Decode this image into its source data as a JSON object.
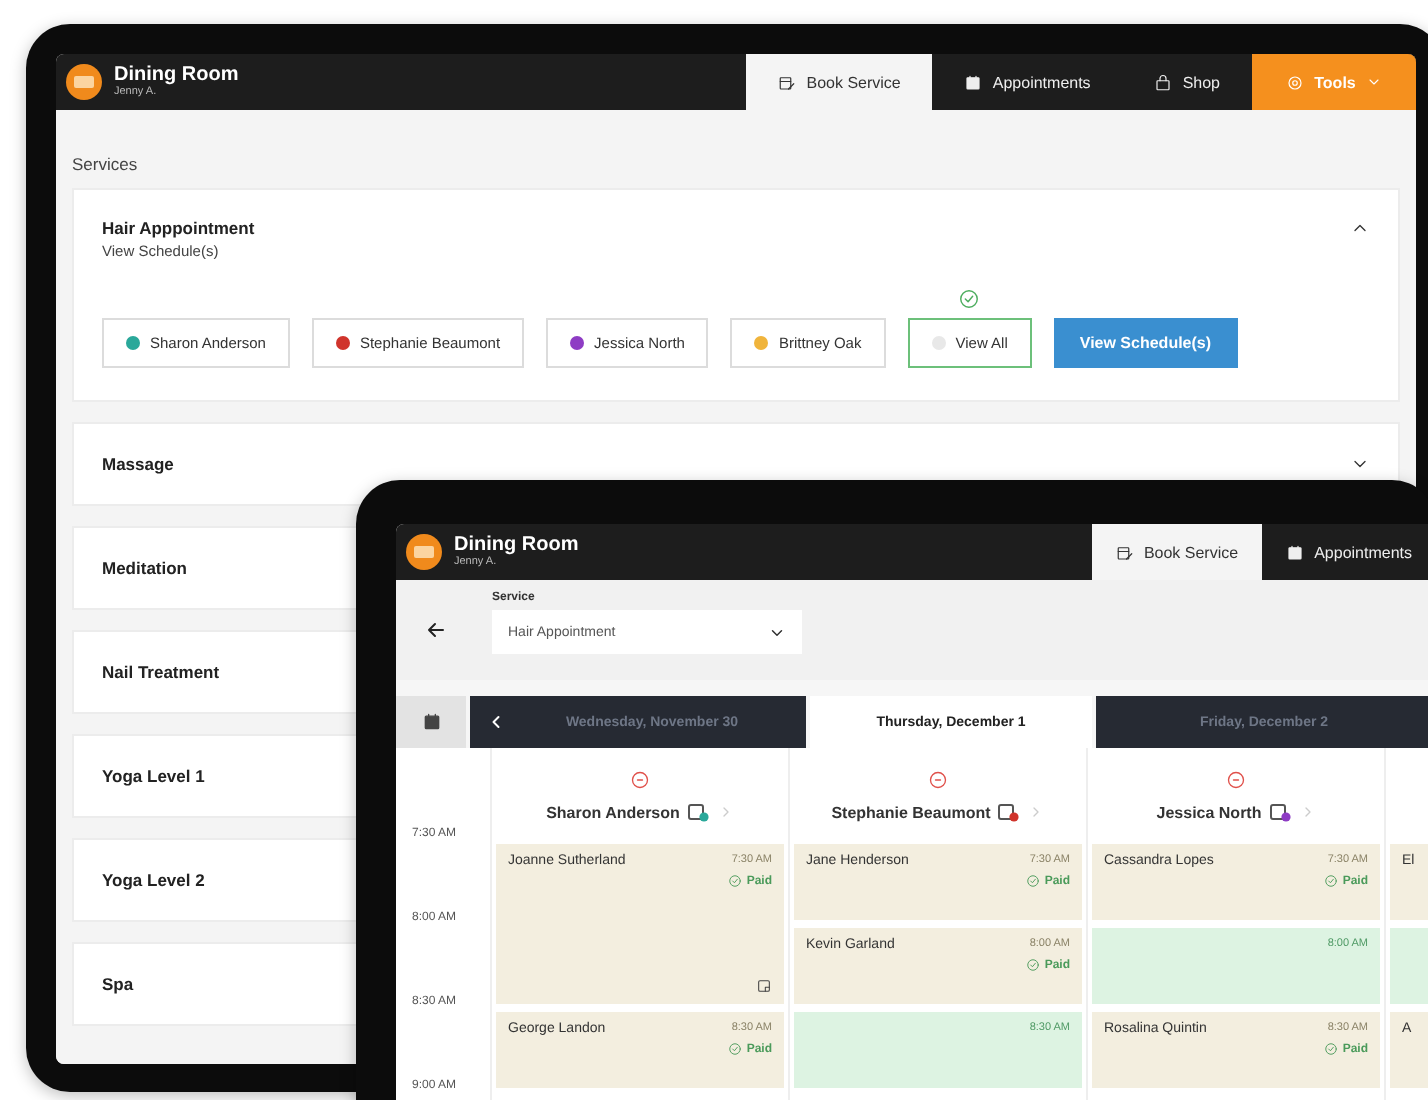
{
  "back_tablet": {
    "header": {
      "title": "Dining Room",
      "subtitle": "Jenny A.",
      "tabs": [
        {
          "label": "Book Service",
          "selected": true,
          "kind": "tab"
        },
        {
          "label": "Appointments",
          "selected": false,
          "kind": "tab"
        },
        {
          "label": "Shop",
          "selected": false,
          "kind": "tab"
        },
        {
          "label": "Tools",
          "selected": false,
          "kind": "menu"
        }
      ]
    },
    "section_label": "Services",
    "services": [
      {
        "name": "Hair Apppointment",
        "subtitle": "View Schedule(s)",
        "expanded": true,
        "staff": [
          {
            "name": "Sharon Anderson",
            "color": "#2aa89a",
            "selected": false
          },
          {
            "name": "Stephanie Beaumont",
            "color": "#d0342c",
            "selected": false
          },
          {
            "name": "Jessica North",
            "color": "#8e3cc4",
            "selected": false
          },
          {
            "name": "Brittney Oak",
            "color": "#f0b43c",
            "selected": false
          },
          {
            "name": "View All",
            "color": "#e8e8e8",
            "selected": true
          }
        ],
        "action": "View Schedule(s)"
      },
      {
        "name": "Massage",
        "expanded": false
      },
      {
        "name": "Meditation",
        "expanded": false
      },
      {
        "name": "Nail Treatment",
        "expanded": false
      },
      {
        "name": "Yoga Level 1",
        "expanded": false
      },
      {
        "name": "Yoga Level 2",
        "expanded": false
      },
      {
        "name": "Spa",
        "expanded": false
      }
    ]
  },
  "front_tablet": {
    "header": {
      "title": "Dining Room",
      "subtitle": "Jenny A.",
      "tabs": [
        {
          "label": "Book Service",
          "selected": true,
          "kind": "tab"
        },
        {
          "label": "Appointments",
          "selected": false,
          "kind": "tab"
        }
      ]
    },
    "service_field": {
      "label": "Service",
      "value": "Hair Appointment"
    },
    "dates": [
      {
        "label": "Wednesday, November 30",
        "selected": false
      },
      {
        "label": "Thursday, December 1",
        "selected": true
      },
      {
        "label": "Friday, December 2",
        "selected": false
      }
    ],
    "time_labels": [
      "7:30 AM",
      "8:00 AM",
      "8:30 AM",
      "9:00 AM"
    ],
    "columns": [
      {
        "name": "Sharon Anderson",
        "color": "#2aa89a",
        "slots": [
          {
            "kind": "booking",
            "client": "Joanne Sutherland",
            "time": "7:30 AM",
            "status": "Paid",
            "note": true
          },
          {
            "kind": "booking",
            "client": "George Landon",
            "time": "8:30 AM",
            "status": "Paid",
            "note": false
          }
        ]
      },
      {
        "name": "Stephanie Beaumont",
        "color": "#d0342c",
        "slots": [
          {
            "kind": "booking",
            "client": "Jane Henderson",
            "time": "7:30 AM",
            "status": "Paid",
            "note": false
          },
          {
            "kind": "booking",
            "client": "Kevin Garland",
            "time": "8:00 AM",
            "status": "Paid",
            "note": false
          },
          {
            "kind": "open",
            "time": "8:30 AM"
          }
        ]
      },
      {
        "name": "Jessica North",
        "color": "#8e3cc4",
        "slots": [
          {
            "kind": "booking",
            "client": "Cassandra Lopes",
            "time": "7:30 AM",
            "status": "Paid",
            "note": false
          },
          {
            "kind": "open",
            "time": "8:00 AM"
          },
          {
            "kind": "booking",
            "client": "Rosalina Quintin",
            "time": "8:30 AM",
            "status": "Paid",
            "note": false
          }
        ]
      },
      {
        "slots": [
          {
            "kind": "booking",
            "client": "El"
          },
          {
            "kind": "open"
          },
          {
            "kind": "booking",
            "client": "A"
          }
        ]
      }
    ]
  }
}
